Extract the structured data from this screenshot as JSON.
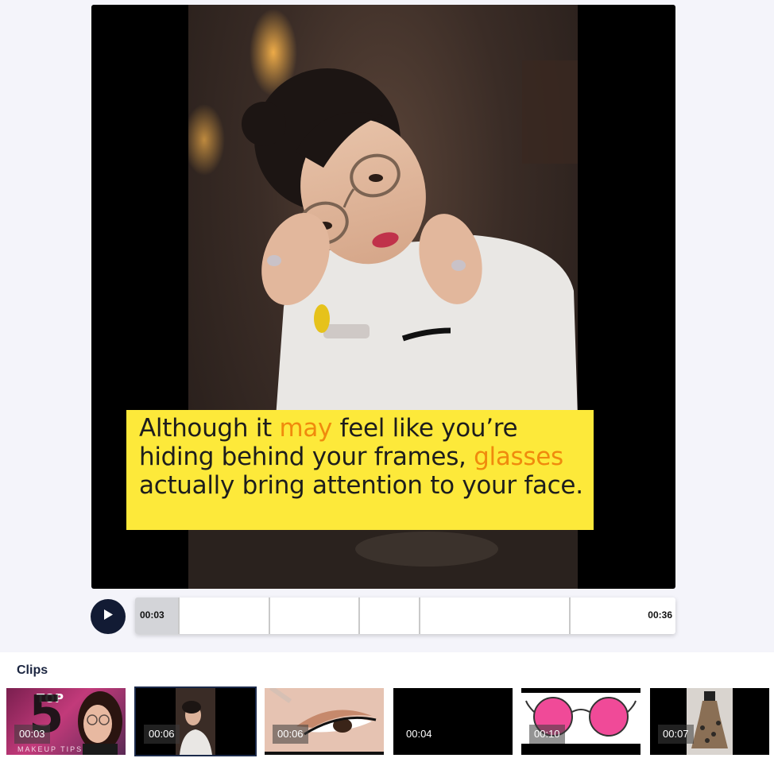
{
  "player": {
    "caption": {
      "t1": "Although it ",
      "h1": "may",
      "t2": " feel like you’re hiding behind your frames, ",
      "h2": "glasses",
      "t3": " actually bring attention to your face."
    },
    "current_time": "00:03",
    "total_time": "00:36",
    "play_icon": "play-icon"
  },
  "clips": {
    "title": "Clips",
    "items": [
      {
        "duration": "00:03",
        "thumb_text": "TOP",
        "thumb_number": "5",
        "thumb_sub": "MAKEUP TIPS"
      },
      {
        "duration": "00:06"
      },
      {
        "duration": "00:06"
      },
      {
        "duration": "00:04"
      },
      {
        "duration": "00:10"
      },
      {
        "duration": "00:07"
      }
    ]
  },
  "colors": {
    "caption_bg": "#fde93a",
    "caption_highlight": "#f08a0d",
    "play_button": "#121b34"
  }
}
